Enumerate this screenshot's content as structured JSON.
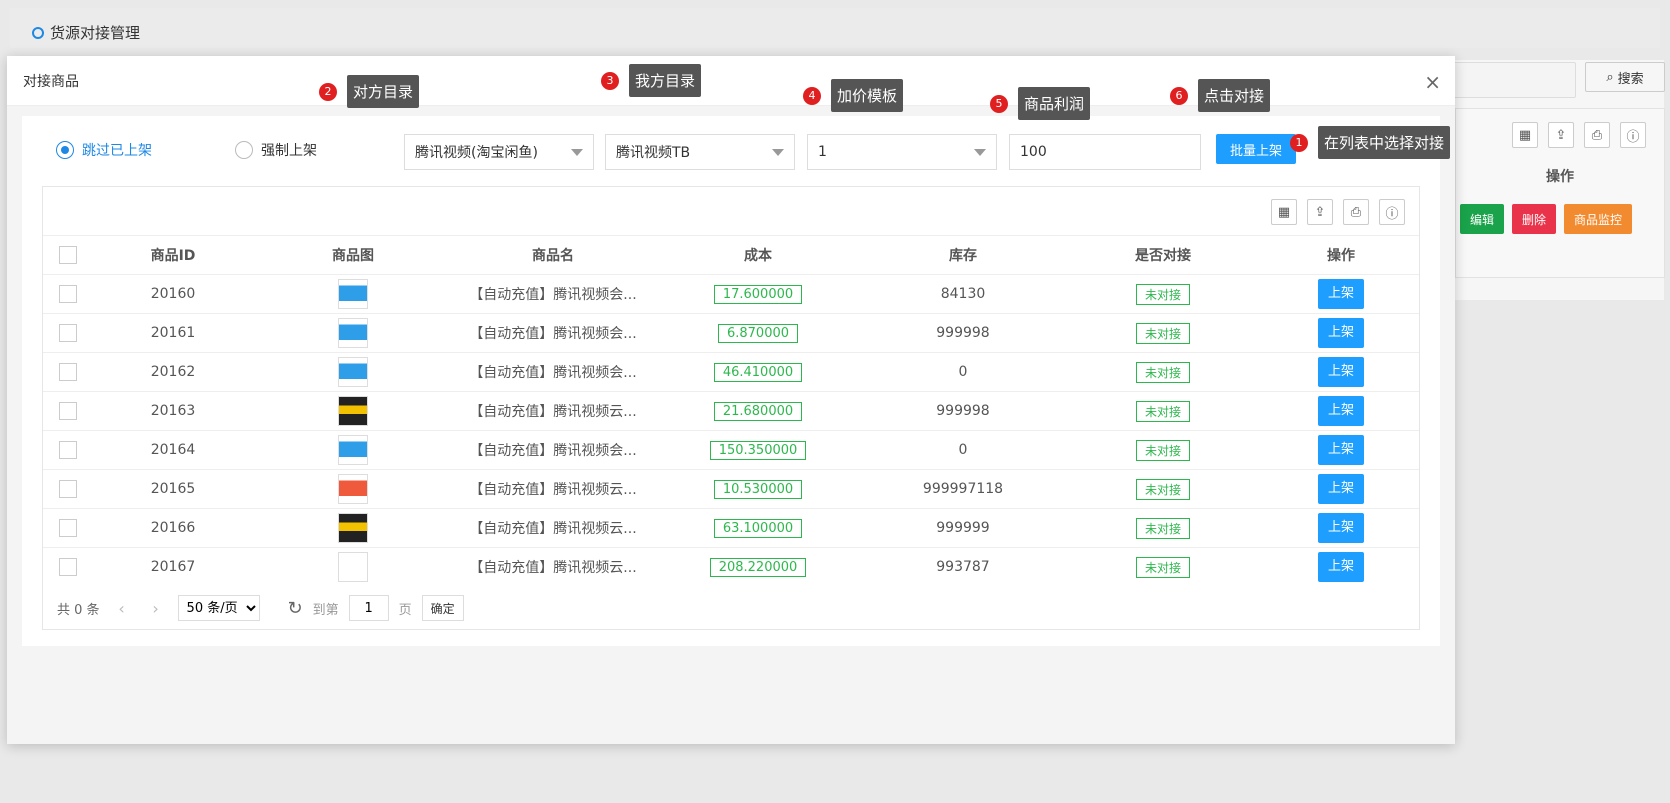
{
  "page": {
    "title": "货源对接管理"
  },
  "background": {
    "search_label": "搜索",
    "op_header": "操作",
    "buttons": [
      {
        "label": "编辑",
        "color": "#1aa34a"
      },
      {
        "label": "删除",
        "color": "#e8334a"
      },
      {
        "label": "商品监控",
        "color": "#f28b30"
      }
    ]
  },
  "modal": {
    "title": "对接商品",
    "close": "×",
    "radios": [
      {
        "label": "跳过已上架",
        "checked": true
      },
      {
        "label": "强制上架",
        "checked": false
      }
    ],
    "their_catalog": "腾讯视频(淘宝闲鱼)",
    "our_catalog": "腾讯视频TB",
    "price_template": "1",
    "profit": "100",
    "batch_button": "批量上架",
    "table": {
      "headers": [
        "商品ID",
        "商品图",
        "商品名",
        "成本",
        "库存",
        "是否对接",
        "操作"
      ],
      "rows": [
        {
          "id": "20160",
          "thumb": "blue",
          "name": "【自动充值】腾讯视频会...",
          "cost": "17.600000",
          "stock": "84130",
          "status": "未对接",
          "action": "上架"
        },
        {
          "id": "20161",
          "thumb": "blue",
          "name": "【自动充值】腾讯视频会...",
          "cost": "6.870000",
          "stock": "999998",
          "status": "未对接",
          "action": "上架"
        },
        {
          "id": "20162",
          "thumb": "blue",
          "name": "【自动充值】腾讯视频会...",
          "cost": "46.410000",
          "stock": "0",
          "status": "未对接",
          "action": "上架"
        },
        {
          "id": "20163",
          "thumb": "dark",
          "name": "【自动充值】腾讯视频云...",
          "cost": "21.680000",
          "stock": "999998",
          "status": "未对接",
          "action": "上架"
        },
        {
          "id": "20164",
          "thumb": "blue",
          "name": "【自动充值】腾讯视频会...",
          "cost": "150.350000",
          "stock": "0",
          "status": "未对接",
          "action": "上架"
        },
        {
          "id": "20165",
          "thumb": "red",
          "name": "【自动充值】腾讯视频云...",
          "cost": "10.530000",
          "stock": "999997118",
          "status": "未对接",
          "action": "上架"
        },
        {
          "id": "20166",
          "thumb": "dark",
          "name": "【自动充值】腾讯视频云...",
          "cost": "63.100000",
          "stock": "999999",
          "status": "未对接",
          "action": "上架"
        },
        {
          "id": "20167",
          "thumb": "empty",
          "name": "【自动充值】腾讯视频云...",
          "cost": "208.220000",
          "stock": "993787",
          "status": "未对接",
          "action": "上架"
        }
      ]
    },
    "pager": {
      "total": "共 0 条",
      "page_size": "50 条/页",
      "goto": "到第",
      "page_value": "1",
      "page_unit": "页",
      "confirm": "确定"
    }
  },
  "notes": [
    {
      "num": "1",
      "label": "在列表中选择对接"
    },
    {
      "num": "2",
      "label": "对方目录"
    },
    {
      "num": "3",
      "label": "我方目录"
    },
    {
      "num": "4",
      "label": "加价模板"
    },
    {
      "num": "5",
      "label": "商品利润"
    },
    {
      "num": "6",
      "label": "点击对接"
    }
  ]
}
